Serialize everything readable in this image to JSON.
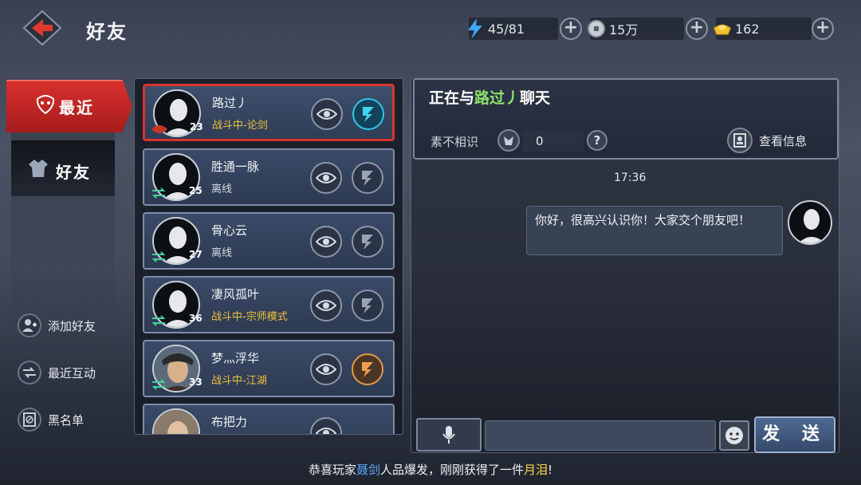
{
  "header": {
    "title": "好友",
    "resources": [
      {
        "icon": "lightning-icon",
        "value": "45/81"
      },
      {
        "icon": "silver-coin-icon",
        "value": "15万"
      },
      {
        "icon": "gold-ingot-icon",
        "value": "162"
      }
    ]
  },
  "nav": {
    "tabs": [
      {
        "label": "最近",
        "active": true,
        "icon": "mask-icon"
      },
      {
        "label": "好友",
        "active": false,
        "icon": "robe-icon"
      }
    ],
    "actions": [
      {
        "label": "添加好友",
        "icon": "add-friend-icon"
      },
      {
        "label": "最近互动",
        "icon": "interact-icon"
      },
      {
        "label": "黑名单",
        "icon": "blacklist-icon"
      }
    ]
  },
  "friends": [
    {
      "name": "路过丿",
      "level": "23",
      "status": "战斗中-论剑",
      "status_color": "#f0c23a",
      "action_icon": "duel-icon",
      "selected": true
    },
    {
      "name": "胜通一脉",
      "level": "25",
      "status": "离线",
      "status_color": "#d6dae0",
      "action_icon": "duel-icon",
      "selected": false
    },
    {
      "name": "骨心云",
      "level": "27",
      "status": "离线",
      "status_color": "#d6dae0",
      "action_icon": "duel-icon",
      "selected": false
    },
    {
      "name": "凄风孤叶",
      "level": "36",
      "status": "战斗中-宗师模式",
      "status_color": "#f0c23a",
      "action_icon": "duel-icon",
      "selected": false
    },
    {
      "name": "梦灬浮华",
      "level": "33",
      "status": "战斗中-江湖",
      "status_color": "#f0c23a",
      "action_icon": "duel-icon",
      "selected": false
    },
    {
      "name": "布把力",
      "level": "",
      "status": "",
      "status_color": "#d6dae0",
      "action_icon": "duel-icon",
      "selected": false
    }
  ],
  "chat": {
    "title_prefix": "正在与",
    "partner": "路过丿",
    "title_suffix": "聊天",
    "relation": "素不相识",
    "intimacy": "0",
    "help": "?",
    "view_info": "查看信息",
    "time": "17:36",
    "message": "你好，很高兴认识你！大家交个朋友吧！",
    "input_value": "",
    "send_label": "发 送"
  },
  "broadcast": {
    "prefix": "恭喜玩家",
    "player": "聂剑",
    "middle": "人品爆发，刚刚获得了一件",
    "item": "月泪",
    "suffix": "!"
  },
  "colors": {
    "accent_red": "#d8302c",
    "friend_name_green": "#8fe26a",
    "gold_status": "#f0c23a"
  }
}
